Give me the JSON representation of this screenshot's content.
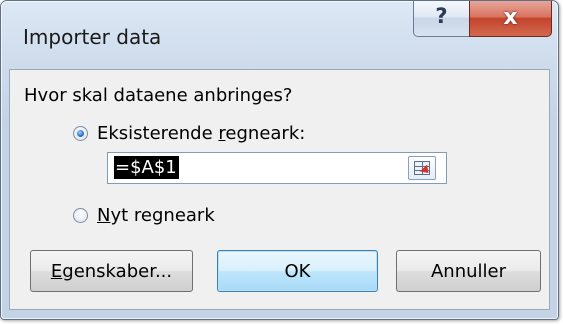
{
  "window": {
    "title": "Importer data",
    "help_label": "?",
    "close_label": "x"
  },
  "content": {
    "question": "Hvor skal dataene anbringes?",
    "existing_sheet": {
      "mnemonic_before": "Eksisterende ",
      "mnemonic_char": "r",
      "mnemonic_after": "egneark:",
      "checked": true
    },
    "reference_value": "=$A$1",
    "new_sheet": {
      "mnemonic_char": "N",
      "mnemonic_after": "yt regneark",
      "checked": false
    }
  },
  "buttons": {
    "properties": {
      "mnemonic_char": "E",
      "rest": "genskaber..."
    },
    "ok": "OK",
    "cancel": "Annuller"
  },
  "icons": {
    "help": "help-icon",
    "close": "close-icon",
    "range_picker": "collapse-dialog-icon"
  }
}
